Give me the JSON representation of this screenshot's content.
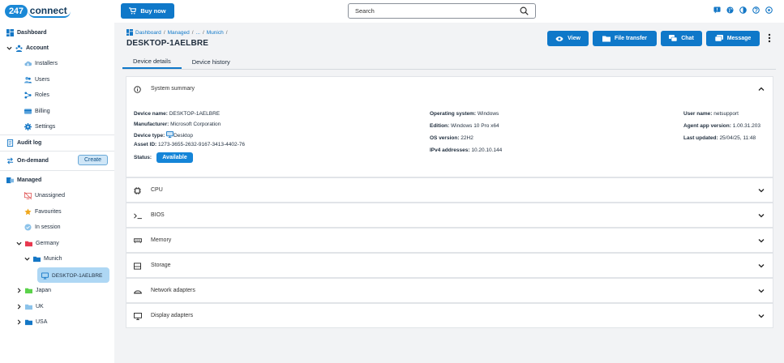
{
  "app": {
    "logo_number": "247",
    "logo_word": "connect"
  },
  "topbar": {
    "buy_label": "Buy now",
    "search_placeholder": "Search",
    "icons": [
      "chat-alert-icon",
      "globe-icon",
      "contrast-icon",
      "help-icon",
      "settings-icon"
    ]
  },
  "sidebar": {
    "dashboard": "Dashboard",
    "account": "Account",
    "installers": "Installers",
    "users": "Users",
    "roles": "Roles",
    "billing": "Billing",
    "settings": "Settings",
    "audit_log": "Audit log",
    "on_demand": "On-demand",
    "create": "Create",
    "managed": "Managed",
    "unassigned": "Unassigned",
    "favourites": "Favourites",
    "in_session": "In session",
    "germany": "Germany",
    "munich": "Munich",
    "device": "DESKTOP-1AELBRE",
    "japan": "Japan",
    "uk": "UK",
    "usa": "USA"
  },
  "breadcrumb": {
    "dashboard": "Dashboard",
    "managed": "Managed",
    "ellipsis": "...",
    "munich": "Munich",
    "sep": "/"
  },
  "page_title": "DESKTOP-1AELBRE",
  "actions": {
    "view": "View",
    "file_transfer": "File transfer",
    "chat": "Chat",
    "message": "Message"
  },
  "tabs": {
    "details": "Device details",
    "history": "Device history"
  },
  "summary": {
    "title": "System summary",
    "col1": {
      "device_name_label": "Device name:",
      "device_name": "DESKTOP-1AELBRE",
      "manufacturer_label": "Manufacturer:",
      "manufacturer": "Microsoft Corporation",
      "device_type_label": "Device type:",
      "device_type": "Desktop",
      "asset_id_label": "Asset ID:",
      "asset_id": "1273-3655-2632-9167-3413-4402-76",
      "status_label": "Status:",
      "status": "Available"
    },
    "col2": {
      "os_label": "Operating system:",
      "os": "Windows",
      "edition_label": "Edition:",
      "edition": "Windows 10 Pro x64",
      "os_version_label": "OS version:",
      "os_version": "22H2",
      "ipv4_label": "IPv4 addresses:",
      "ipv4": "10.20.10.144"
    },
    "col3": {
      "user_label": "User name:",
      "user": "netsupport",
      "agent_label": "Agent app version:",
      "agent": "1.00.31.203",
      "updated_label": "Last updated:",
      "updated": "25/04/25, 11:48"
    }
  },
  "sections": {
    "cpu": "CPU",
    "bios": "BIOS",
    "memory": "Memory",
    "storage": "Storage",
    "network": "Network adapters",
    "display": "Display adapters"
  },
  "colors": {
    "primary": "#0f78c9",
    "selected": "#aed7f4",
    "background": "#f2f3f5"
  }
}
